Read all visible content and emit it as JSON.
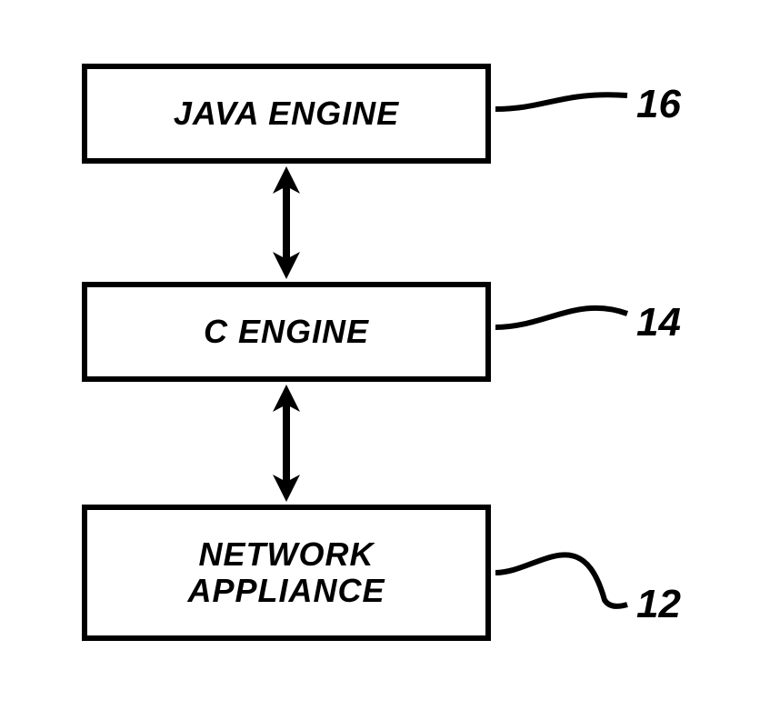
{
  "diagram": {
    "boxes": {
      "top": {
        "label": "JAVA ENGINE",
        "ref": "16"
      },
      "middle": {
        "label": "C ENGINE",
        "ref": "14"
      },
      "bottom": {
        "label": "NETWORK\nAPPLIANCE",
        "ref": "12"
      }
    }
  }
}
